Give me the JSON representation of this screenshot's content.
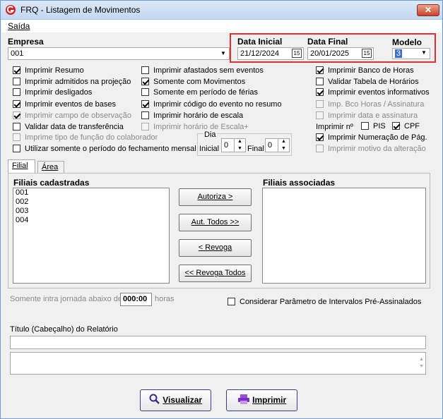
{
  "window": {
    "title": "FRQ - Listagem de Movimentos",
    "close": "✕"
  },
  "menu": {
    "saida": "Saída"
  },
  "empresa": {
    "label": "Empresa",
    "value": "001"
  },
  "data_inicial": {
    "label": "Data Inicial",
    "value": "21/12/2024",
    "cal": "15"
  },
  "data_final": {
    "label": "Data Final",
    "value": "20/01/2025",
    "cal": "15"
  },
  "modelo": {
    "label": "Modelo",
    "value": "3"
  },
  "options_col1": [
    {
      "label": "Imprimir Resumo",
      "checked": true,
      "enabled": true
    },
    {
      "label": "Imprimir admitidos na projeção",
      "checked": false,
      "enabled": true
    },
    {
      "label": "Imprimir desligados",
      "checked": false,
      "enabled": true
    },
    {
      "label": "Imprimir eventos de bases",
      "checked": true,
      "enabled": true
    },
    {
      "label": "Imprimir campo de observação",
      "checked": true,
      "enabled": false
    },
    {
      "label": "Validar data de transferência",
      "checked": false,
      "enabled": true
    },
    {
      "label": "Imprime tipo de função do colaborador",
      "checked": false,
      "enabled": false
    },
    {
      "label": "Utilizar somente o período do fechamento mensal",
      "checked": false,
      "enabled": true
    }
  ],
  "options_col2": [
    {
      "label": "Imprimir afastados sem eventos",
      "checked": false,
      "enabled": true
    },
    {
      "label": "Somente com Movimentos",
      "checked": true,
      "enabled": true
    },
    {
      "label": "Somente em período de férias",
      "checked": false,
      "enabled": true
    },
    {
      "label": "Imprimir código do evento no resumo",
      "checked": true,
      "enabled": true
    },
    {
      "label": "Imprimir horário de escala",
      "checked": false,
      "enabled": true
    },
    {
      "label": "Imprimir horário de Escala+",
      "checked": false,
      "enabled": false
    }
  ],
  "options_col3": [
    {
      "label": "Imprimir Banco de Horas",
      "checked": true,
      "enabled": true
    },
    {
      "label": "Validar Tabela de Horários",
      "checked": false,
      "enabled": true
    },
    {
      "label": "Imprimir eventos informativos",
      "checked": true,
      "enabled": true
    },
    {
      "label": "Imp. Bco Horas / Assinatura",
      "checked": false,
      "enabled": false
    },
    {
      "label": "Imprimir data e assinatura",
      "checked": false,
      "enabled": false
    }
  ],
  "imprimir_n": {
    "label": "Imprimir nº",
    "pis": "PIS",
    "pis_checked": false,
    "cpf": "CPF",
    "cpf_checked": true
  },
  "numeracao": {
    "label": "Imprimir Numeração de Pág.",
    "checked": true
  },
  "motivo": {
    "label": "Imprimir motivo da alteração",
    "checked": false
  },
  "dia": {
    "label": "Dia",
    "inicial_label": "Inicial",
    "inicial_value": "0",
    "final_label": "Final",
    "final_value": "0"
  },
  "tabs": {
    "filial": "Filial",
    "area": "Área"
  },
  "filiais_cadastradas": {
    "label": "Filiais cadastradas",
    "items": [
      "001",
      "002",
      "003",
      "004"
    ]
  },
  "filiais_associadas": {
    "label": "Filiais associadas"
  },
  "buttons": {
    "autoriza": "Autoriza >",
    "aut_todos": "Aut. Todos >>",
    "revoga": "< Revoga",
    "revoga_todos": "<< Revoga Todos"
  },
  "intrajornada": {
    "label": "Somente intra jornada abaixo de",
    "value": "000:00",
    "unit": "horas"
  },
  "considerar": {
    "label": "Considerar Parâmetro de Intervalos Pré-Assinalados",
    "checked": false
  },
  "titulo": {
    "label": "Título (Cabeçalho) do Relatório",
    "value": ""
  },
  "actions": {
    "visualizar": "Visualizar",
    "imprimir": "Imprimir"
  },
  "colors": {
    "highlight": "#e03030",
    "title_bar": "#c4d8f1",
    "logo": "#d22222"
  }
}
